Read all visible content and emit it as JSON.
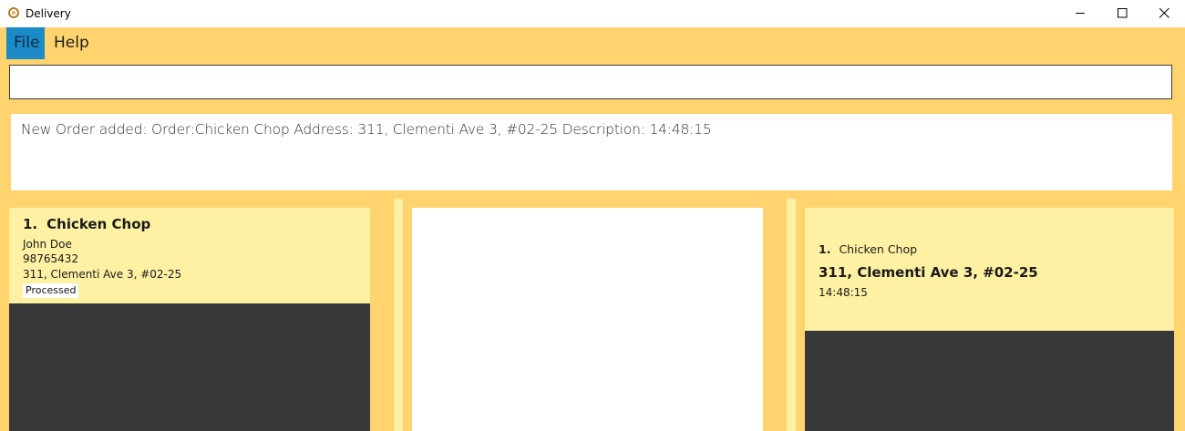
{
  "window": {
    "title": "Delivery",
    "controls": [
      "minimize",
      "maximize",
      "close"
    ]
  },
  "menu": {
    "items": [
      {
        "label": "File",
        "selected": true
      },
      {
        "label": "Help",
        "selected": false
      }
    ]
  },
  "command": {
    "value": "",
    "placeholder": ""
  },
  "result": {
    "text": "New Order added:  Order:Chicken Chop Address: 311, Clementi Ave 3, #02-25 Description: 14:48:15"
  },
  "order_list": {
    "items": [
      {
        "index": "1.",
        "name": "Chicken Chop",
        "customer": "John Doe",
        "phone": "98765432",
        "address": "311, Clementi Ave 3, #02-25",
        "status": "Processed"
      }
    ]
  },
  "delivery_list": {
    "items": [
      {
        "index": "1.",
        "order": "Chicken Chop",
        "address": "311, Clementi Ave 3, #02-25",
        "time": "14:48:15"
      }
    ]
  },
  "colors": {
    "background": "#ffd36e",
    "card": "#fff1a3",
    "panel_dark": "#383838",
    "menu_selected": "#1b8ac7"
  }
}
